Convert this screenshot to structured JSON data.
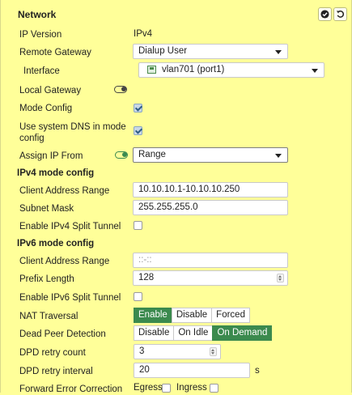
{
  "header": {
    "title": "Network"
  },
  "rows": {
    "ip_version": {
      "label": "IP Version",
      "value": "IPv4"
    },
    "remote_gateway": {
      "label": "Remote Gateway",
      "value": "Dialup User"
    },
    "interface": {
      "label": "Interface",
      "value": "vlan701 (port1)"
    },
    "local_gateway": {
      "label": "Local Gateway",
      "enabled": false
    },
    "mode_config": {
      "label": "Mode Config",
      "checked": true
    },
    "use_system_dns": {
      "label_line1": "Use system DNS in mode",
      "label_line2": "config",
      "checked": true
    },
    "assign_ip_from": {
      "label": "Assign IP From",
      "enabled": true,
      "value": "Range"
    }
  },
  "ipv4": {
    "section_title": "IPv4 mode config",
    "client_address_range": {
      "label": "Client Address Range",
      "value": "10.10.10.1-10.10.10.250"
    },
    "subnet_mask": {
      "label": "Subnet Mask",
      "value": "255.255.255.0"
    },
    "split_tunnel": {
      "label": "Enable IPv4 Split Tunnel",
      "checked": false
    }
  },
  "ipv6": {
    "section_title": "IPv6 mode config",
    "client_address_range": {
      "label": "Client Address Range",
      "placeholder": "::-::"
    },
    "prefix_length": {
      "label": "Prefix Length",
      "value": "128"
    },
    "split_tunnel": {
      "label": "Enable IPv6 Split Tunnel",
      "checked": false
    }
  },
  "nat_traversal": {
    "label": "NAT Traversal",
    "options": [
      "Enable",
      "Disable",
      "Forced"
    ],
    "selected": "Enable"
  },
  "dead_peer_detection": {
    "label": "Dead Peer Detection",
    "options": [
      "Disable",
      "On Idle",
      "On Demand"
    ],
    "selected": "On Demand"
  },
  "dpd_retry_count": {
    "label": "DPD retry count",
    "value": "3"
  },
  "dpd_retry_interval": {
    "label": "DPD retry interval",
    "value": "20",
    "unit": "s"
  },
  "fec": {
    "label": "Forward Error Correction",
    "egress_label": "Egress",
    "ingress_label": "Ingress",
    "egress": false,
    "ingress": false
  },
  "colors": {
    "panel_bg": "#ffff99",
    "active_green": "#3b8a4e"
  }
}
